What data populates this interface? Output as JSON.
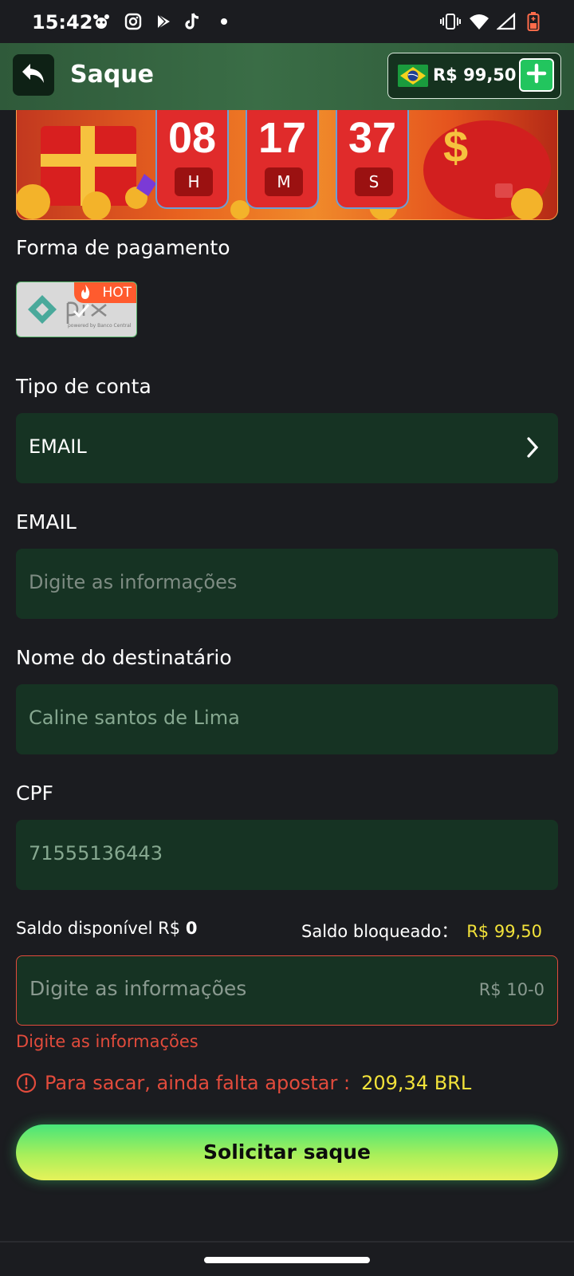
{
  "status_bar": {
    "time": "15:42",
    "left_icons": [
      "pawprint-icon",
      "instagram-icon",
      "play-store-icon",
      "tiktok-icon",
      "dot-icon"
    ],
    "right_icons": [
      "vibrate-icon",
      "wifi-icon",
      "signal-icon",
      "battery-low-icon"
    ]
  },
  "header": {
    "title": "Saque",
    "balance": "R$ 99,50",
    "back_icon": "back-arrow-icon",
    "add_icon": "plus-icon"
  },
  "countdown": {
    "hours": "08",
    "hours_unit": "H",
    "minutes": "17",
    "minutes_unit": "M",
    "seconds": "37",
    "seconds_unit": "S"
  },
  "payment": {
    "label": "Forma de pagamento",
    "method": "pix",
    "method_tagline": "powered by Banco Central",
    "badge": "HOT"
  },
  "account_type": {
    "label": "Tipo de conta",
    "value": "EMAIL"
  },
  "email": {
    "label": "EMAIL",
    "placeholder": "Digite as informações"
  },
  "recipient": {
    "label": "Nome do destinatário",
    "value": "Caline santos de Lima"
  },
  "cpf": {
    "label": "CPF",
    "value": "71555136443"
  },
  "balances": {
    "available_label": "Saldo disponível R$",
    "available_value": "0",
    "blocked_label": "Saldo bloqueado：",
    "blocked_value": "R$ 99,50"
  },
  "amount": {
    "placeholder": "Digite as informações",
    "range_hint": "R$ 10-0",
    "error": "Digite as informações"
  },
  "warning": {
    "text": "Para sacar, ainda falta apostar :",
    "amount": "209,34 BRL"
  },
  "submit": {
    "label": "Solicitar saque"
  },
  "colors": {
    "background": "#1b1c20",
    "field": "#163323",
    "header": "#2f5a3a",
    "accent_yellow": "#f2e23a",
    "error_red": "#e24b3c",
    "green": "#22c55e"
  }
}
